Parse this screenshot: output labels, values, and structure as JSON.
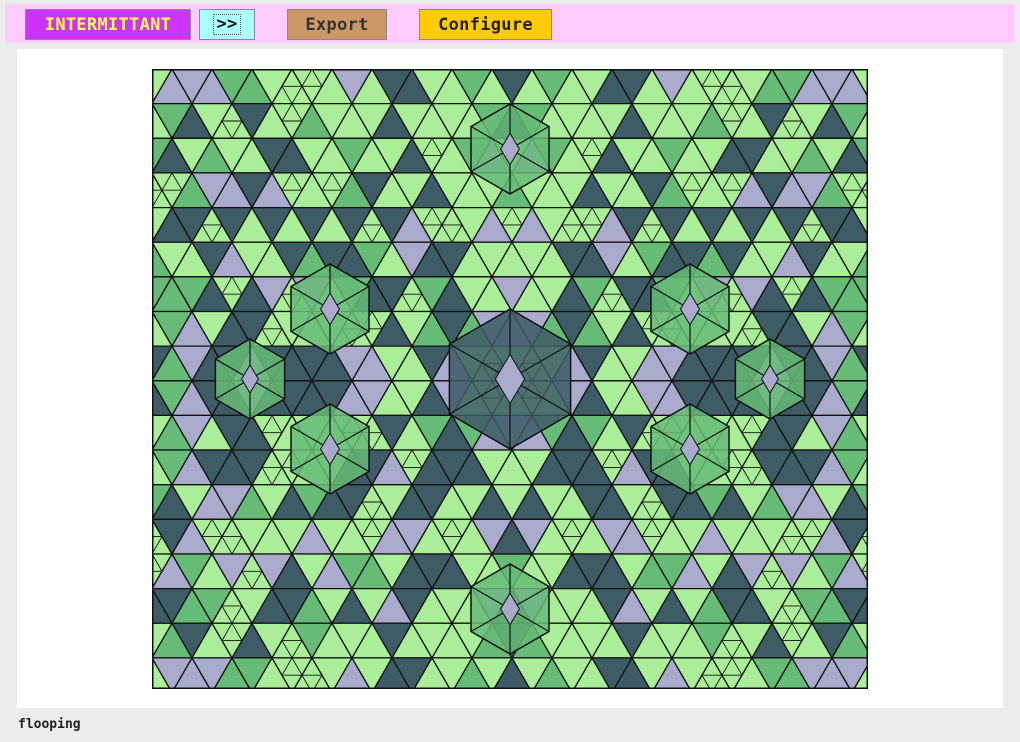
{
  "toolbar": {
    "intermittant_label": "INTERMITTANT",
    "next_label": ">>",
    "export_label": "Export",
    "configure_label": "Configure"
  },
  "status": {
    "text": "flooping"
  },
  "colors": {
    "toolbar_bg": "#ffccff",
    "intermittant_bg": "#cc33ff",
    "intermittant_text": "#ffff44",
    "next_bg": "#aaffff",
    "export_bg": "#cc9966",
    "configure_bg": "#ffcc00",
    "tile_light": "#aaee99",
    "tile_mid": "#66bb77",
    "tile_dark": "#3d5c66",
    "tile_lavender": "#aaaacc",
    "tile_stroke": "#111111"
  },
  "canvas": {
    "icon": "tiling-pattern-canvas"
  }
}
